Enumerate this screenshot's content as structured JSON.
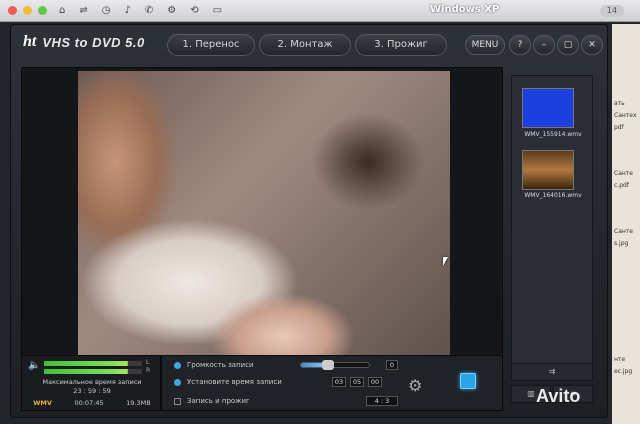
{
  "host": {
    "window_title": "Windows XP",
    "badge": "14",
    "icons": [
      "⌂",
      "⇌",
      "◷",
      "♪",
      "✆",
      "⚙",
      "⟲",
      "▭"
    ]
  },
  "app": {
    "logo_prefix": "ht",
    "logo_title": "VHS to DVD 5.0",
    "steps": [
      {
        "label": "1. Перенос"
      },
      {
        "label": "2. Монтаж"
      },
      {
        "label": "3. Прожиг"
      }
    ],
    "controls": {
      "menu": "MENU",
      "help": "?",
      "minimize": "–",
      "maximize": "▢",
      "close": "✕"
    }
  },
  "thumbnails": [
    {
      "label": "WMV_155914.wmv",
      "color": "#1c3fe0"
    },
    {
      "label": "WMV_164016.wmv",
      "color": "#8a5a2a"
    }
  ],
  "side_buttons": {
    "forward": "⇉",
    "trash": "▥",
    "list": "≡"
  },
  "meter": {
    "left_label": "L",
    "right_label": "R",
    "max_record_label": "Максимальное время записи",
    "max_record_time": "23 : 59 : 59",
    "format": "WMV",
    "elapsed": "00:07:45",
    "size": "19.3MB"
  },
  "options": {
    "volume_label": "Громкость записи",
    "volume_level": 0.4,
    "volume_value": "0",
    "set_time_label": "Установите время записи",
    "time_h": "03",
    "time_m": "05",
    "time_s": "00",
    "record_burn_label": "Запись и прожиг",
    "aspect": "4 : 3"
  },
  "desktop": {
    "labels": [
      "ать",
      "Сантех",
      "pdf",
      "Санте",
      "с.pdf",
      "Санте",
      "s.jpg",
      "нте",
      "ес.jpg"
    ]
  },
  "watermark": "Avito"
}
